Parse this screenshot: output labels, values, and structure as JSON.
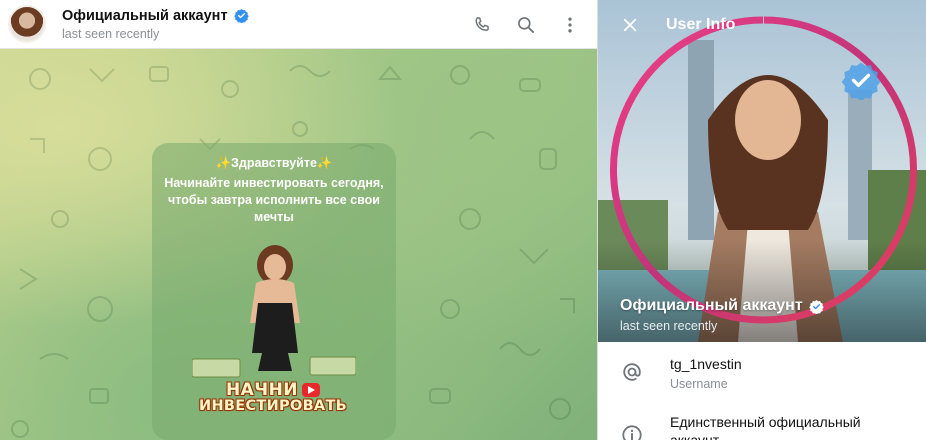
{
  "chat": {
    "name": "Официальный аккаунт",
    "status": "last seen recently",
    "icons": {
      "verified": "verified-badge-icon",
      "call": "phone-icon",
      "search": "search-icon",
      "more": "more-vertical-icon"
    }
  },
  "welcome": {
    "greeting": "✨Здравствуйте✨",
    "text": "Начинайте инвестировать сегодня, чтобы завтра исполнить все свои мечты",
    "promo_line1": "НАЧНИ",
    "promo_line2": "ИНВЕСТИРОВАТЬ"
  },
  "user_info": {
    "title": "User Info",
    "name": "Официальный аккаунт",
    "status": "last seen recently",
    "username": "tg_1nvestin",
    "username_label": "Username",
    "bio": "Единственный официальный аккаунт",
    "icons": {
      "close": "close-icon",
      "username": "at-sign-icon",
      "bio": "info-icon"
    }
  },
  "colors": {
    "verified_blue": "#3390ec",
    "accent_magenta": "#d4307a",
    "secondary_text": "#8a8f94"
  }
}
